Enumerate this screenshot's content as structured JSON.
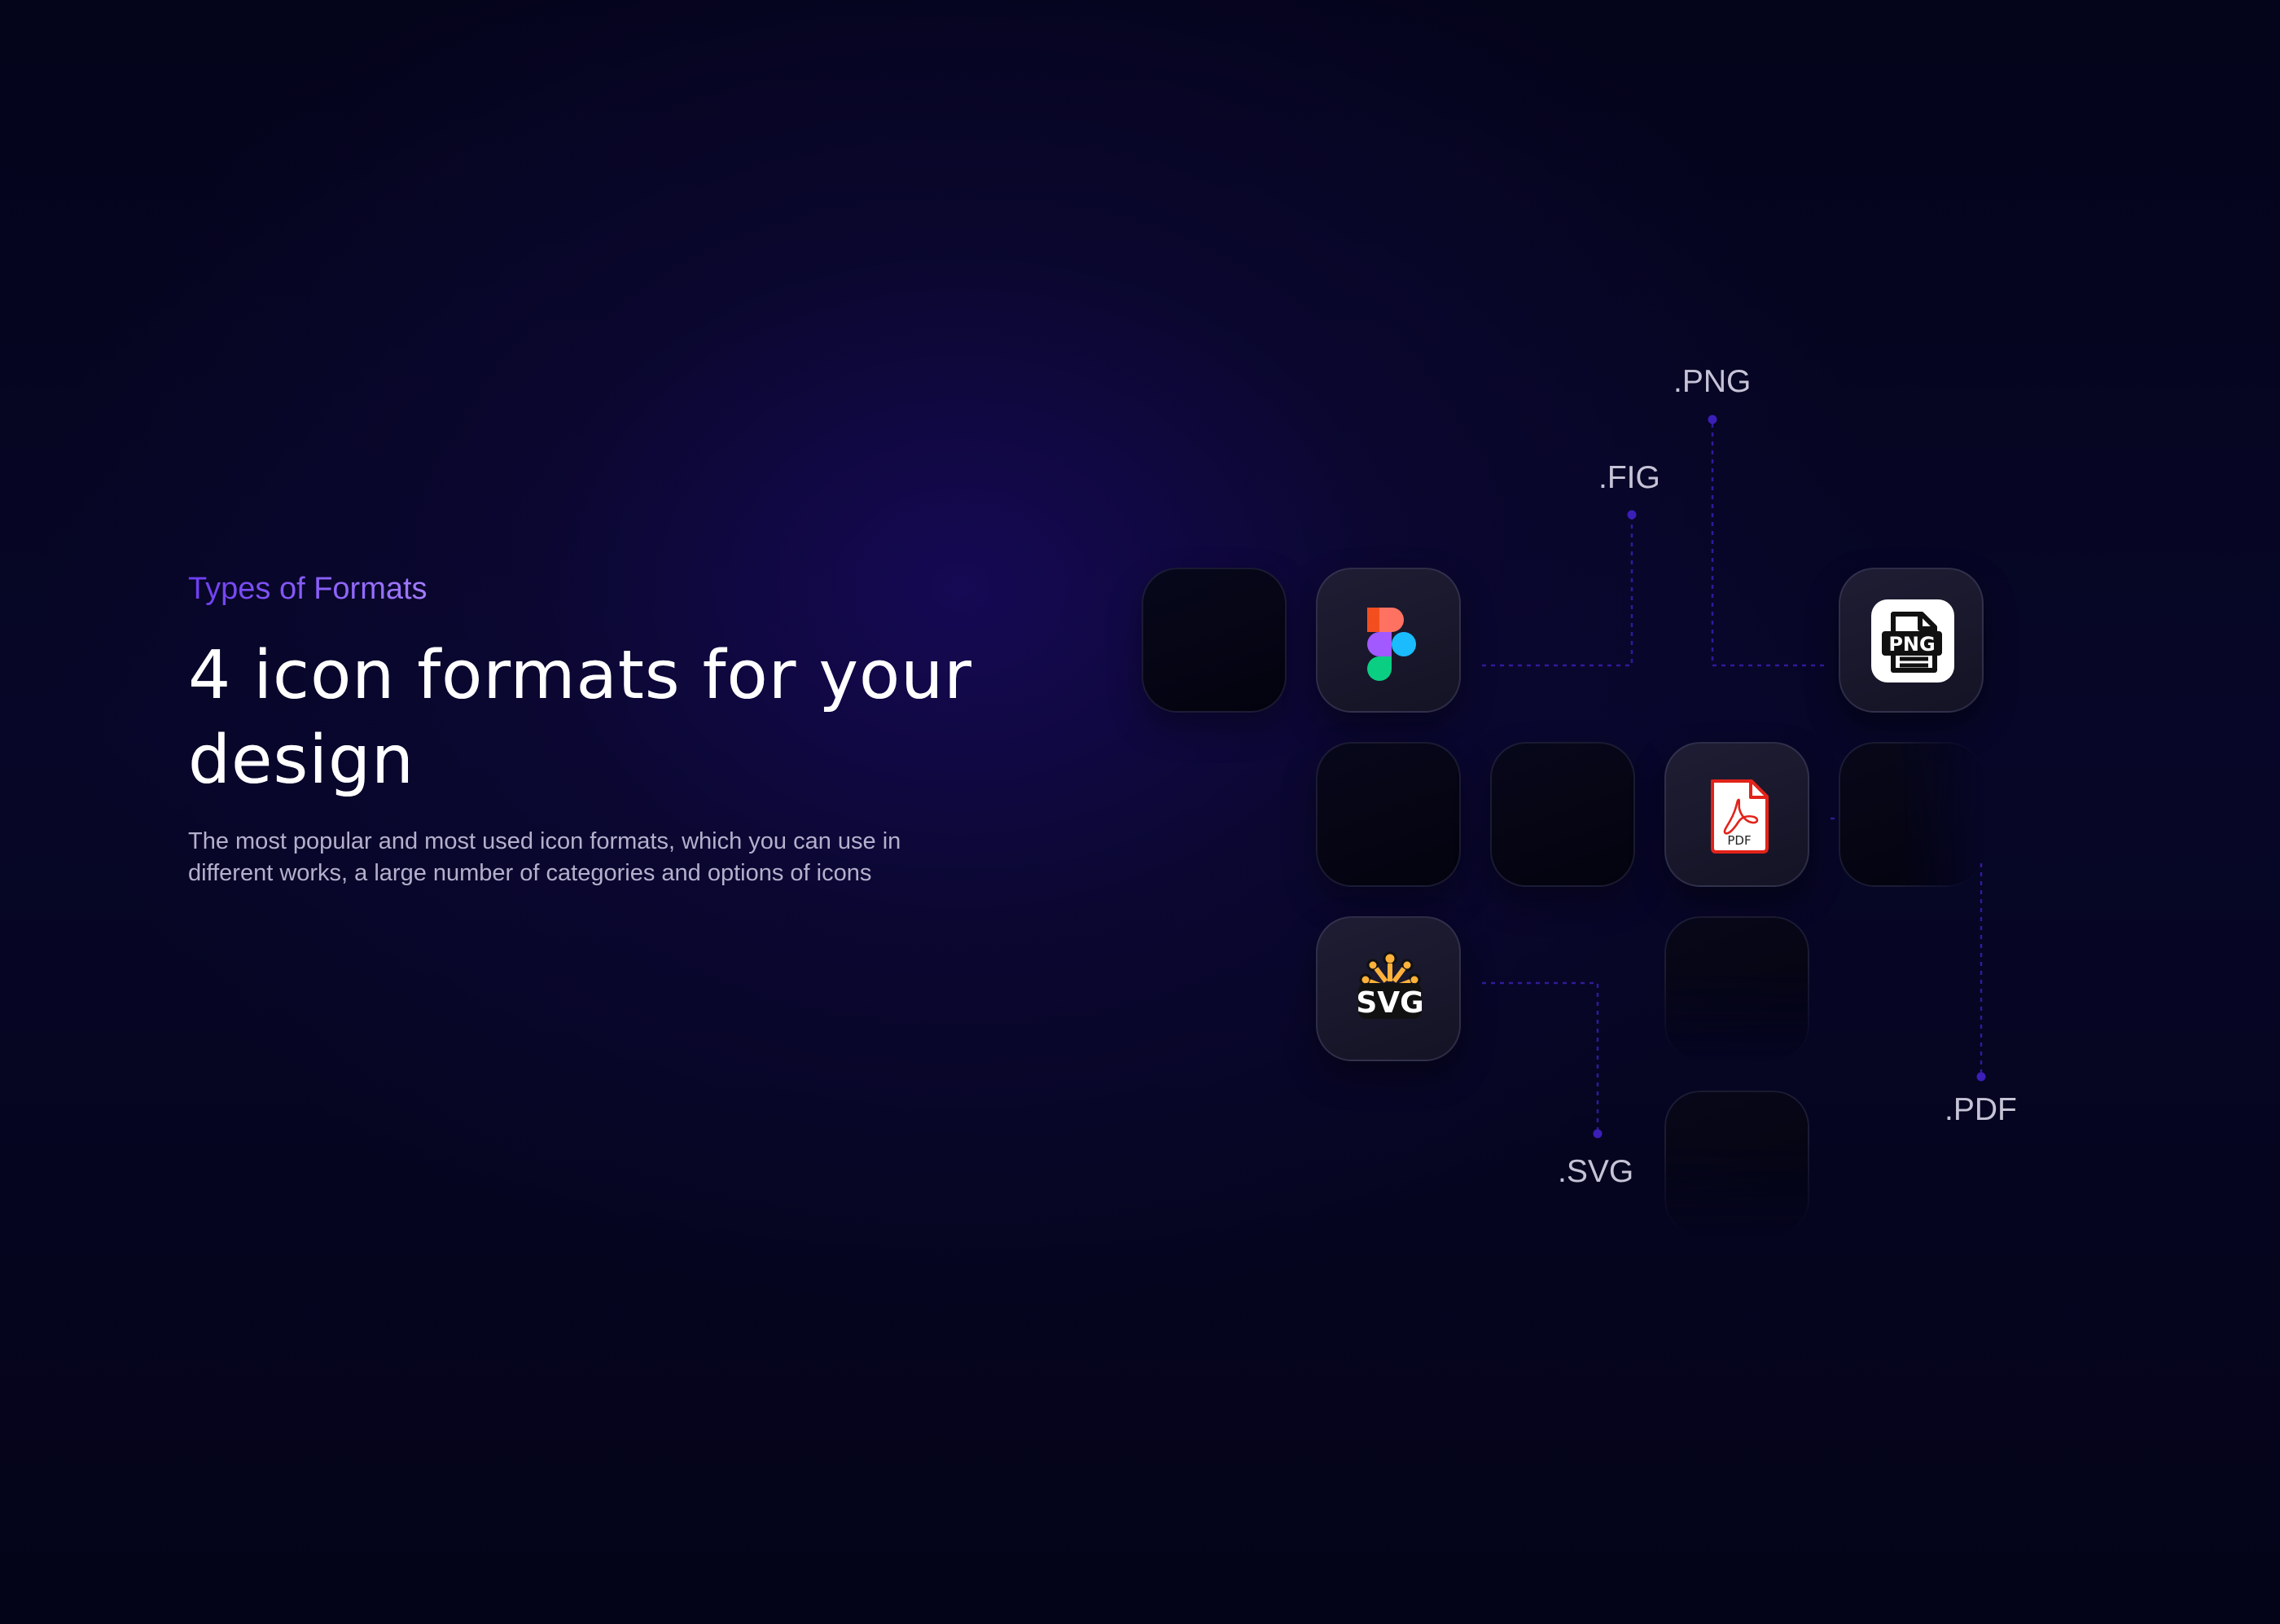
{
  "section": {
    "eyebrow": "Types of Formats",
    "title": "4  icon formats for your design",
    "description": "The most popular and most used icon formats, which you can use in different works, a large number of categories and options of icons"
  },
  "formats": {
    "png": ".PNG",
    "fig": ".FIG",
    "pdf": ".PDF",
    "svg": ".SVG"
  },
  "icons": {
    "figma": "figma-icon",
    "png": "png-file-icon",
    "pdf": "pdf-file-icon",
    "svg": "svg-logo-icon",
    "png_badge_text": "PNG",
    "pdf_badge_text": "PDF",
    "svg_badge_text": "SVG"
  },
  "colors": {
    "accent_start": "#6d3df0",
    "accent_end": "#a27cff",
    "connector": "#3b1fb8",
    "background": "#05051a"
  }
}
